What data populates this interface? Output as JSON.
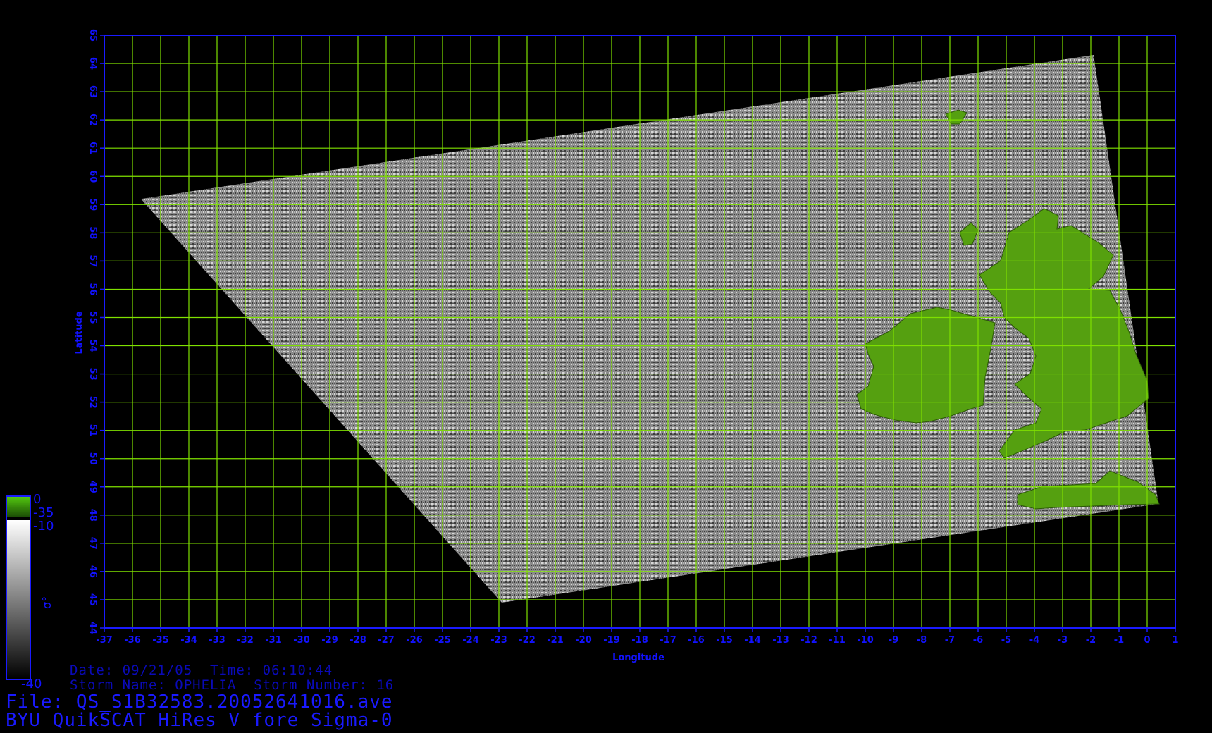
{
  "map": {
    "lon_min": -37,
    "lon_max": 1,
    "lat_min": 44,
    "lat_max": 65,
    "x_ticks": [
      -37,
      -36,
      -35,
      -34,
      -33,
      -32,
      -31,
      -30,
      -29,
      -28,
      -27,
      -26,
      -25,
      -24,
      -23,
      -22,
      -21,
      -20,
      -19,
      -18,
      -17,
      -16,
      -15,
      -14,
      -13,
      -12,
      -11,
      -10,
      -9,
      -8,
      -7,
      -6,
      -5,
      -4,
      -3,
      -2,
      -1,
      0,
      1
    ],
    "y_ticks": [
      44,
      45,
      46,
      47,
      48,
      49,
      50,
      51,
      52,
      53,
      54,
      55,
      56,
      57,
      58,
      59,
      60,
      61,
      62,
      63,
      64,
      65
    ],
    "xlabel": "Longitude",
    "ylabel": "Latitude",
    "grid": true,
    "colors": {
      "axis": "#1a1aff",
      "grid": "#7fe000",
      "land": "#55a010",
      "background": "#000000"
    }
  },
  "swath_corners_lonlat": [
    [
      -35.7,
      59.2
    ],
    [
      -1.9,
      64.3
    ],
    [
      0.4,
      48.4
    ],
    [
      -22.9,
      44.9
    ]
  ],
  "colorbar": {
    "labels": {
      "top": "0",
      "mid1": "-35",
      "mid2": "-10",
      "bottom": "-40",
      "symbol": "σ°"
    }
  },
  "info": {
    "date_line": "Date: 09/21/05  Time: 06:10:44",
    "storm_line": "Storm Name: OPHELIA  Storm Number: 16",
    "file_line": "File: QS_S1B32583.20052641016.ave",
    "product_line": "BYU QuikSCAT HiRes V fore Sigma-0"
  }
}
